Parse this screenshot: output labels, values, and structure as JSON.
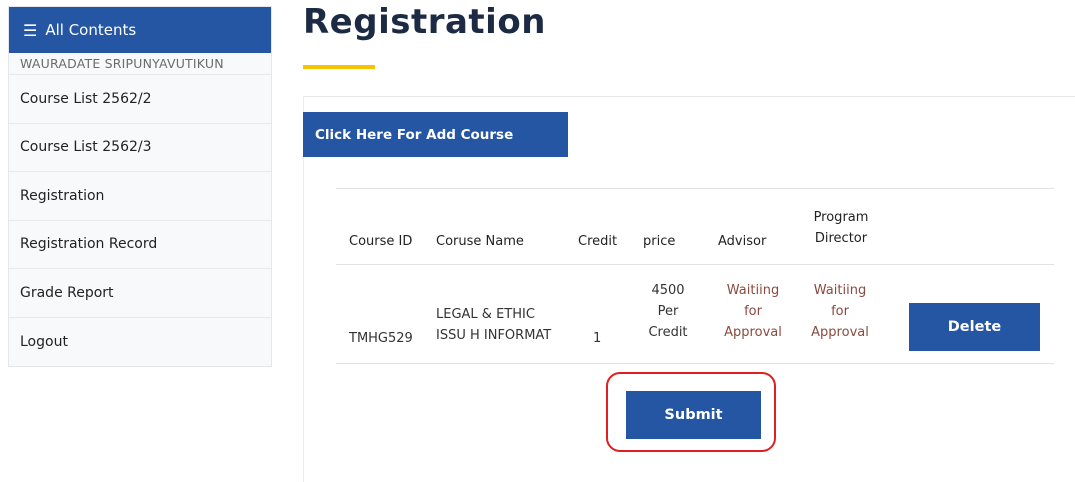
{
  "sidebar": {
    "menu_icon": "hamburger-icon",
    "header_label": "All Contents",
    "user_name": "WAURADATE SRIPUNYAVUTIKUN",
    "items": [
      {
        "label": "Course List 2562/2"
      },
      {
        "label": "Course List 2562/3"
      },
      {
        "label": "Registration"
      },
      {
        "label": "Registration Record"
      },
      {
        "label": "Grade Report"
      },
      {
        "label": "Logout"
      }
    ]
  },
  "main": {
    "title": "Registration",
    "add_course_label": "Click Here For Add Course",
    "table": {
      "headers": {
        "course_id": "Course ID",
        "course_name": "Coruse Name",
        "credit": "Credit",
        "price": "price",
        "advisor": "Advisor",
        "program_director_line1": "Program",
        "program_director_line2": "Director"
      },
      "rows": [
        {
          "course_id": "TMHG529",
          "course_name_line1": "LEGAL & ETHIC",
          "course_name_line2": "ISSU H INFORMAT",
          "credit": "1",
          "price_line1": "4500",
          "price_line2": "Per",
          "price_line3": "Credit",
          "advisor_line1": "Waitiing",
          "advisor_line2": "for",
          "advisor_line3": "Approval",
          "director_line1": "Waitiing",
          "director_line2": "for",
          "director_line3": "Approval",
          "delete_label": "Delete"
        }
      ]
    },
    "submit_label": "Submit"
  },
  "colors": {
    "primary": "#2456a4",
    "accent_underline": "#f5c400",
    "status_text": "#8a4a3e",
    "highlight_border": "#e02020"
  }
}
